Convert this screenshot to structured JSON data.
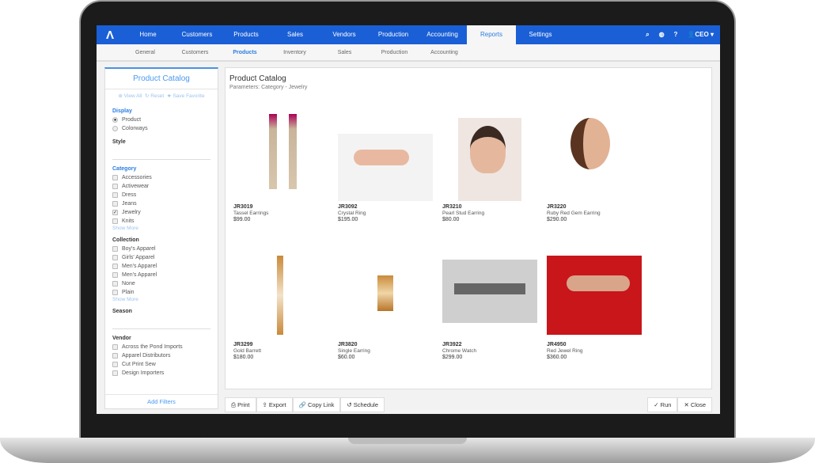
{
  "brand": {
    "accent": "#1a5fd6",
    "link": "#2a7de1"
  },
  "topnav": {
    "items": [
      "Home",
      "Customers",
      "Products",
      "Sales",
      "Vendors",
      "Production",
      "Accounting",
      "Reports",
      "Settings"
    ],
    "active": "Reports",
    "user": "CEO"
  },
  "subnav": {
    "items": [
      "General",
      "Customers",
      "Products",
      "Inventory",
      "Sales",
      "Production",
      "Accounting"
    ],
    "active": "Products"
  },
  "sidebar": {
    "title": "Product Catalog",
    "actions": {
      "view_all": "View All",
      "reset": "Reset",
      "save": "Save Favorite"
    },
    "display": {
      "label": "Display",
      "options": [
        "Product",
        "Colorways"
      ],
      "selected": "Product"
    },
    "style": "Style",
    "category": {
      "label": "Category",
      "options": [
        "Accessories",
        "Activewear",
        "Dress",
        "Jeans",
        "Jewelry",
        "Knits"
      ],
      "checked": "Jewelry",
      "more": "Show More"
    },
    "collection": {
      "label": "Collection",
      "options": [
        "Boy's Apparel",
        "Girls' Apparel",
        "Men's Apparel",
        "Men's Apparel",
        "None",
        "Plain"
      ],
      "more": "Show More"
    },
    "season": "Season",
    "vendor": {
      "label": "Vendor",
      "options": [
        "Across the Pond Imports",
        "Apparel Distributors",
        "Cut Print Sew",
        "Design Importers"
      ]
    },
    "add_filters": "Add Filters"
  },
  "main": {
    "title": "Product Catalog",
    "params": "Parameters: Category - Jewelry",
    "products": [
      {
        "sku": "JR3019",
        "name": "Tassel Earrings",
        "price": "$99.00"
      },
      {
        "sku": "JR3092",
        "name": "Crystal Ring",
        "price": "$195.00"
      },
      {
        "sku": "JR3210",
        "name": "Pearl Stud Earring",
        "price": "$80.00"
      },
      {
        "sku": "JR3220",
        "name": "Ruby Red Gem Earring",
        "price": "$290.00"
      },
      {
        "sku": "JR3299",
        "name": "Gold Barrett",
        "price": "$180.00"
      },
      {
        "sku": "JR3820",
        "name": "Single Earring",
        "price": "$60.00"
      },
      {
        "sku": "JR3922",
        "name": "Chrome Watch",
        "price": "$299.00"
      },
      {
        "sku": "JR4950",
        "name": "Red Jewel Ring",
        "price": "$360.00"
      }
    ]
  },
  "toolbar": {
    "print": "Print",
    "export": "Export",
    "copy": "Copy Link",
    "schedule": "Schedule",
    "run": "Run",
    "close": "Close"
  }
}
